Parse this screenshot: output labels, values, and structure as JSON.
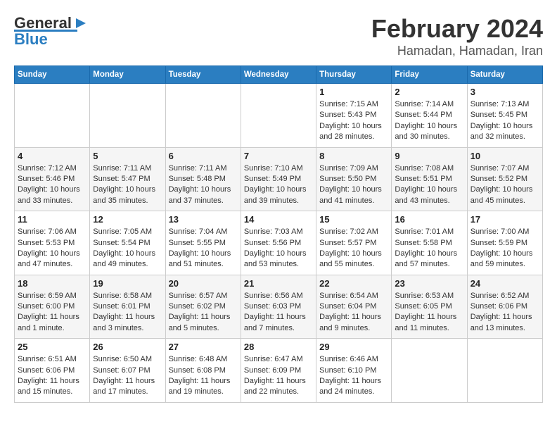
{
  "logo": {
    "line1": "General",
    "line2": "Blue"
  },
  "title": "February 2024",
  "subtitle": "Hamadan, Hamadan, Iran",
  "days_of_week": [
    "Sunday",
    "Monday",
    "Tuesday",
    "Wednesday",
    "Thursday",
    "Friday",
    "Saturday"
  ],
  "weeks": [
    [
      {
        "day": "",
        "info": ""
      },
      {
        "day": "",
        "info": ""
      },
      {
        "day": "",
        "info": ""
      },
      {
        "day": "",
        "info": ""
      },
      {
        "day": "1",
        "info": "Sunrise: 7:15 AM\nSunset: 5:43 PM\nDaylight: 10 hours\nand 28 minutes."
      },
      {
        "day": "2",
        "info": "Sunrise: 7:14 AM\nSunset: 5:44 PM\nDaylight: 10 hours\nand 30 minutes."
      },
      {
        "day": "3",
        "info": "Sunrise: 7:13 AM\nSunset: 5:45 PM\nDaylight: 10 hours\nand 32 minutes."
      }
    ],
    [
      {
        "day": "4",
        "info": "Sunrise: 7:12 AM\nSunset: 5:46 PM\nDaylight: 10 hours\nand 33 minutes."
      },
      {
        "day": "5",
        "info": "Sunrise: 7:11 AM\nSunset: 5:47 PM\nDaylight: 10 hours\nand 35 minutes."
      },
      {
        "day": "6",
        "info": "Sunrise: 7:11 AM\nSunset: 5:48 PM\nDaylight: 10 hours\nand 37 minutes."
      },
      {
        "day": "7",
        "info": "Sunrise: 7:10 AM\nSunset: 5:49 PM\nDaylight: 10 hours\nand 39 minutes."
      },
      {
        "day": "8",
        "info": "Sunrise: 7:09 AM\nSunset: 5:50 PM\nDaylight: 10 hours\nand 41 minutes."
      },
      {
        "day": "9",
        "info": "Sunrise: 7:08 AM\nSunset: 5:51 PM\nDaylight: 10 hours\nand 43 minutes."
      },
      {
        "day": "10",
        "info": "Sunrise: 7:07 AM\nSunset: 5:52 PM\nDaylight: 10 hours\nand 45 minutes."
      }
    ],
    [
      {
        "day": "11",
        "info": "Sunrise: 7:06 AM\nSunset: 5:53 PM\nDaylight: 10 hours\nand 47 minutes."
      },
      {
        "day": "12",
        "info": "Sunrise: 7:05 AM\nSunset: 5:54 PM\nDaylight: 10 hours\nand 49 minutes."
      },
      {
        "day": "13",
        "info": "Sunrise: 7:04 AM\nSunset: 5:55 PM\nDaylight: 10 hours\nand 51 minutes."
      },
      {
        "day": "14",
        "info": "Sunrise: 7:03 AM\nSunset: 5:56 PM\nDaylight: 10 hours\nand 53 minutes."
      },
      {
        "day": "15",
        "info": "Sunrise: 7:02 AM\nSunset: 5:57 PM\nDaylight: 10 hours\nand 55 minutes."
      },
      {
        "day": "16",
        "info": "Sunrise: 7:01 AM\nSunset: 5:58 PM\nDaylight: 10 hours\nand 57 minutes."
      },
      {
        "day": "17",
        "info": "Sunrise: 7:00 AM\nSunset: 5:59 PM\nDaylight: 10 hours\nand 59 minutes."
      }
    ],
    [
      {
        "day": "18",
        "info": "Sunrise: 6:59 AM\nSunset: 6:00 PM\nDaylight: 11 hours\nand 1 minute."
      },
      {
        "day": "19",
        "info": "Sunrise: 6:58 AM\nSunset: 6:01 PM\nDaylight: 11 hours\nand 3 minutes."
      },
      {
        "day": "20",
        "info": "Sunrise: 6:57 AM\nSunset: 6:02 PM\nDaylight: 11 hours\nand 5 minutes."
      },
      {
        "day": "21",
        "info": "Sunrise: 6:56 AM\nSunset: 6:03 PM\nDaylight: 11 hours\nand 7 minutes."
      },
      {
        "day": "22",
        "info": "Sunrise: 6:54 AM\nSunset: 6:04 PM\nDaylight: 11 hours\nand 9 minutes."
      },
      {
        "day": "23",
        "info": "Sunrise: 6:53 AM\nSunset: 6:05 PM\nDaylight: 11 hours\nand 11 minutes."
      },
      {
        "day": "24",
        "info": "Sunrise: 6:52 AM\nSunset: 6:06 PM\nDaylight: 11 hours\nand 13 minutes."
      }
    ],
    [
      {
        "day": "25",
        "info": "Sunrise: 6:51 AM\nSunset: 6:06 PM\nDaylight: 11 hours\nand 15 minutes."
      },
      {
        "day": "26",
        "info": "Sunrise: 6:50 AM\nSunset: 6:07 PM\nDaylight: 11 hours\nand 17 minutes."
      },
      {
        "day": "27",
        "info": "Sunrise: 6:48 AM\nSunset: 6:08 PM\nDaylight: 11 hours\nand 19 minutes."
      },
      {
        "day": "28",
        "info": "Sunrise: 6:47 AM\nSunset: 6:09 PM\nDaylight: 11 hours\nand 22 minutes."
      },
      {
        "day": "29",
        "info": "Sunrise: 6:46 AM\nSunset: 6:10 PM\nDaylight: 11 hours\nand 24 minutes."
      },
      {
        "day": "",
        "info": ""
      },
      {
        "day": "",
        "info": ""
      }
    ]
  ]
}
